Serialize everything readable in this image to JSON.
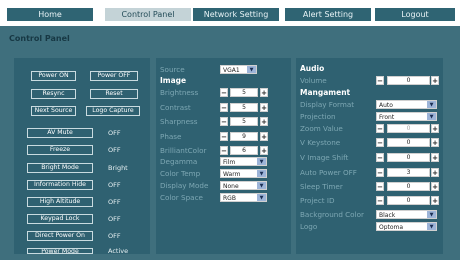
{
  "nav": {
    "home": "Home",
    "control_panel": "Control Panel",
    "network_setting": "Network Setting",
    "alert_setting": "Alert Setting",
    "logout": "Logout"
  },
  "page_title": "Control Panel",
  "left": {
    "power_on": "Power ON",
    "power_off": "Power OFF",
    "resync": "Resync",
    "reset": "Reset",
    "next_source": "Next Source",
    "logo_capture": "Logo Capture",
    "rows": [
      {
        "label": "AV Mute",
        "value": "OFF"
      },
      {
        "label": "Freeze",
        "value": "OFF"
      },
      {
        "label": "Bright Mode",
        "value": "Bright"
      },
      {
        "label": "Information Hide",
        "value": "OFF"
      },
      {
        "label": "High Altitude",
        "value": "OFF"
      },
      {
        "label": "Keypad Lock",
        "value": "OFF"
      },
      {
        "label": "Direct Power On",
        "value": "OFF"
      },
      {
        "label": "Power Mode",
        "value": "Active"
      }
    ]
  },
  "middle": {
    "source_label": "Source",
    "source_value": "VGA1",
    "image_heading": "Image",
    "brightness_label": "Brightness",
    "brightness_value": "5",
    "contrast_label": "Contrast",
    "contrast_value": "5",
    "sharpness_label": "Sharpness",
    "sharpness_value": "5",
    "phase_label": "Phase",
    "phase_value": "9",
    "brilliantcolor_label": "BrilliantColor",
    "brilliantcolor_value": "6",
    "degamma_label": "Degamma",
    "degamma_value": "Film",
    "color_temp_label": "Color Temp",
    "color_temp_value": "Warm",
    "display_mode_label": "Display Mode",
    "display_mode_value": "None",
    "color_space_label": "Color Space",
    "color_space_value": "RGB"
  },
  "right": {
    "audio_heading": "Audio",
    "volume_label": "Volume",
    "volume_value": "0",
    "management_heading": "Mangament",
    "display_format_label": "Display Format",
    "display_format_value": "Auto",
    "projection_label": "Projection",
    "projection_value": "Front",
    "zoom_label": "Zoom Value",
    "zoom_value": "0",
    "v_keystone_label": "V Keystone",
    "v_keystone_value": "0",
    "v_image_shift_label": "V Image Shift",
    "v_image_shift_value": "0",
    "auto_power_off_label": "Auto Power OFF",
    "auto_power_off_value": "3",
    "sleep_timer_label": "Sleep Timer",
    "sleep_timer_value": "0",
    "project_id_label": "Project ID",
    "project_id_value": "0",
    "background_color_label": "Background Color",
    "background_color_value": "Black",
    "logo_label": "Logo",
    "logo_value": "Optoma"
  },
  "glyphs": {
    "minus": "−",
    "plus": "+",
    "arrow": "▼"
  },
  "colors": {
    "background": "#3f6f7d",
    "panel": "#2f6171",
    "nav_tab": "#2f6473",
    "nav_active": "#c4d3d7",
    "muted_label": "#7da7b3"
  }
}
